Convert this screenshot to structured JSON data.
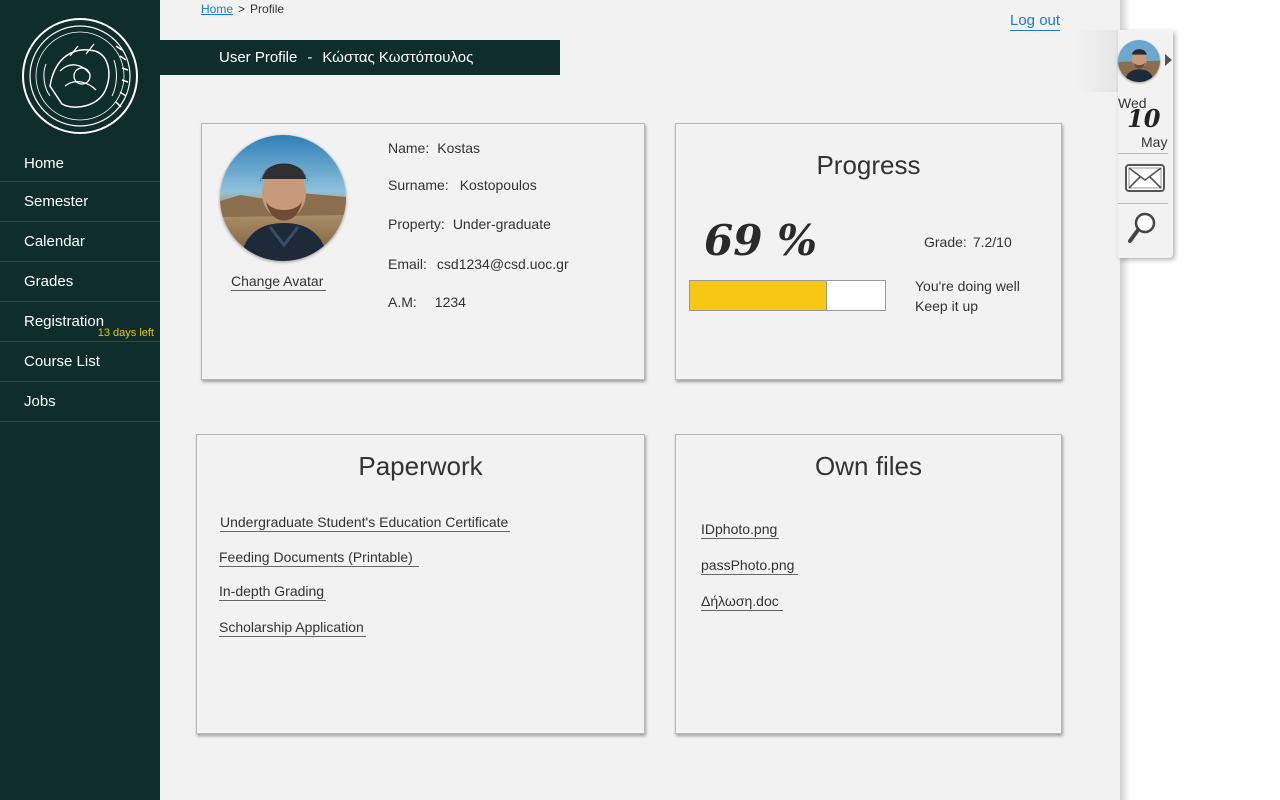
{
  "sidebar": {
    "items": [
      {
        "label": "Home"
      },
      {
        "label": "Semester"
      },
      {
        "label": "Calendar"
      },
      {
        "label": "Grades"
      },
      {
        "label": "Registration",
        "badge": "13 days left"
      },
      {
        "label": "Course List"
      },
      {
        "label": "Jobs"
      }
    ]
  },
  "breadcrumb": {
    "home": "Home",
    "separator": ">",
    "current": "Profile"
  },
  "header": {
    "logout": "Log out",
    "title_prefix": "User Profile",
    "title_dash": "-",
    "user_name": "Κώστας Κωστόπουλος"
  },
  "profile": {
    "change_avatar": "Change Avatar",
    "name_label": "Name:",
    "name_value": "Kostas",
    "surname_label": "Surname:",
    "surname_value": "Kostopoulos",
    "property_label": "Property:",
    "property_value": "Under-graduate",
    "email_label": "Email:",
    "email_value": "csd1234@csd.uoc.gr",
    "am_label": "A.M:",
    "am_value": "1234"
  },
  "progress": {
    "title": "Progress",
    "percent_text": "69 %",
    "percent": 69,
    "grade_label": "Grade:",
    "grade_value": "7.2/10",
    "message_line1": "You're doing well",
    "message_line2": "Keep it up"
  },
  "paperwork": {
    "title": "Paperwork",
    "items": [
      {
        "label": "Undergraduate Student's Education Certificate"
      },
      {
        "label": "Feeding Documents (Printable)"
      },
      {
        "label": "In-depth Grading"
      },
      {
        "label": "Scholarship Application"
      }
    ]
  },
  "files": {
    "title": "Own files",
    "items": [
      {
        "label": "IDphoto.png"
      },
      {
        "label": "passPhoto.png"
      },
      {
        "label": "Δήλωση.doc"
      }
    ]
  },
  "widget": {
    "day": "Wed",
    "date": "10",
    "month": "May",
    "mail_icon": "mail-icon",
    "search_icon": "search-icon"
  },
  "colors": {
    "sidebar": "#0f2d2b",
    "accent_link": "#1e7bc6",
    "progress_fill": "#f7c713",
    "badge": "#e3c21a",
    "panel": "#f2f2f2"
  }
}
